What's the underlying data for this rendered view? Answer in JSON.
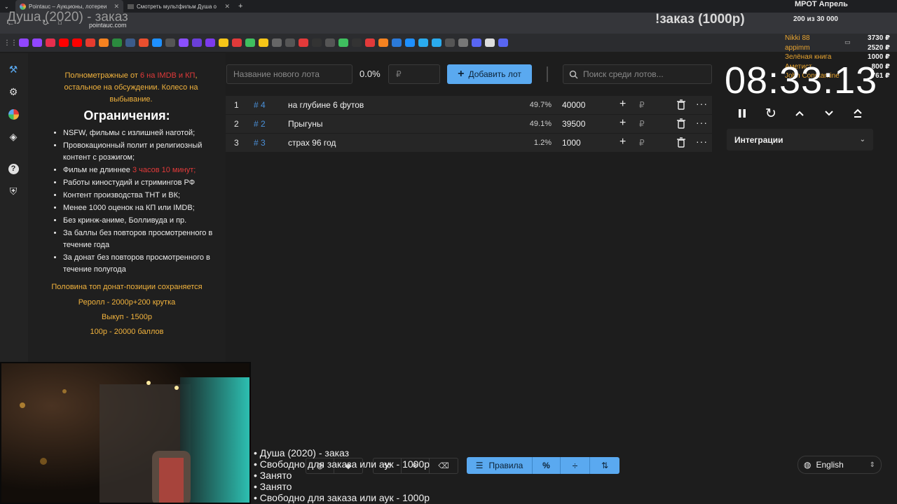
{
  "browser": {
    "tabs": [
      {
        "title": "Pointauc – Аукционы, лотереи"
      },
      {
        "title": "Смотреть мультфильм Душа о"
      }
    ],
    "url": "pointauc.com"
  },
  "overlay": {
    "stream_title": "Душа (2020) - заказ",
    "order_title": "!заказ (1000р)",
    "wage_title": "МРОТ Апрель",
    "wage_progress": "200 из 30 000",
    "donors": [
      {
        "name": "Nikki 88",
        "amount": "3730 ₽"
      },
      {
        "name": "appimm",
        "amount": "2520 ₽"
      },
      {
        "name": "Зелёная книга",
        "amount": "1000 ₽"
      },
      {
        "name": "Аметист",
        "amount": "800 ₽"
      },
      {
        "name": "John Constantine",
        "amount": "761 ₽"
      }
    ]
  },
  "rules": {
    "intro_pre": "Полнометражные от ",
    "intro_red": "6 на IMDB и КП",
    "intro_post": ", остальное на обсуждении. Колесо на выбывание.",
    "heading": "Ограничения:",
    "items": [
      {
        "text": "NSFW, фильмы с излишней наготой;"
      },
      {
        "text": "Провокационный полит и религиозный контент с розжигом;"
      },
      {
        "text": "Фильм не длиннее ",
        "red": "3 часов 10 минут;"
      },
      {
        "text": "Работы киностудий и стримингов РФ"
      },
      {
        "text": "Контент производства ТНТ и ВК;"
      },
      {
        "text": "Менее 1000 оценок на КП или IMDB;"
      },
      {
        "text": "Без кринж-аниме, Болливуда и пр."
      },
      {
        "text": "За баллы без повторов просмотренного в течение года"
      },
      {
        "text": "За донат без повторов просмотренного в течение полугода"
      }
    ],
    "footer": [
      "Половина топ донат-позиции сохраняется",
      "Реролл - 2000р+200 крутка",
      "Выкуп - 1500р",
      "100р - 20000 баллов"
    ]
  },
  "controls": {
    "lot_name_placeholder": "Название нового лота",
    "percent": "0.0%",
    "price_placeholder": "₽",
    "add_lot_label": "Добавить лот",
    "search_placeholder": "Поиск среди лотов..."
  },
  "lots": [
    {
      "num": "1",
      "id": "# 4",
      "name": "на глубине 6 футов",
      "percent": "49.7%",
      "amount": "40000"
    },
    {
      "num": "2",
      "id": "# 2",
      "name": "Прыгуны",
      "percent": "49.1%",
      "amount": "39500"
    },
    {
      "num": "3",
      "id": "# 3",
      "name": "страх 96 год",
      "percent": "1.2%",
      "amount": "1000"
    }
  ],
  "timer": {
    "value": "08:33:13"
  },
  "integrations_label": "Интеграции",
  "bottom": {
    "rules_label": "Правила",
    "language": "English"
  },
  "queue": [
    "• Душа (2020) - заказ",
    "• Свободно для заказа или аук - 1000р",
    "• Занято",
    "• Занято",
    "• Свободно для заказа или аук - 1000р"
  ],
  "colors": {
    "accent": "#5aa9f0",
    "highlight_text": "#f2b33d",
    "warning_red": "#e23a3a",
    "lot_id": "#4a90d9"
  }
}
